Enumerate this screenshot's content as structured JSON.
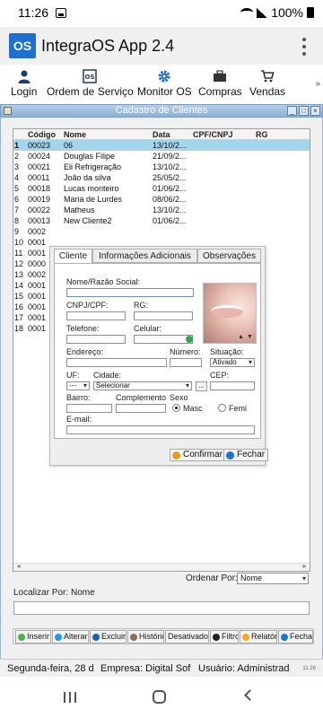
{
  "status_bar": {
    "time": "11:26",
    "battery": "100%"
  },
  "app_bar": {
    "logo": "OS",
    "title": "IntegraOS App 2.4",
    "menu_icon": "more-vert-icon"
  },
  "toolbar": {
    "items": [
      {
        "label": "Login",
        "icon": "person-icon"
      },
      {
        "label": "Ordem de Serviço",
        "icon": "service-order-icon"
      },
      {
        "label": "Monitor OS",
        "icon": "gear-icon"
      },
      {
        "label": "Compras",
        "icon": "briefcase-icon"
      },
      {
        "label": "Vendas",
        "icon": "cart-icon"
      }
    ],
    "more": "»"
  },
  "window": {
    "title": "Cadastro de Clientes"
  },
  "grid": {
    "columns": [
      "Código",
      "Nome",
      "Data",
      "CPF/CNPJ",
      "RG"
    ],
    "rows": [
      {
        "n": "1",
        "codigo": "00023",
        "nome": "06",
        "data": "13/10/2..."
      },
      {
        "n": "2",
        "codigo": "00024",
        "nome": "Douglas Filipe",
        "data": "21/09/2..."
      },
      {
        "n": "3",
        "codigo": "00021",
        "nome": "Eli Refrigeração",
        "data": "13/10/2..."
      },
      {
        "n": "4",
        "codigo": "00011",
        "nome": "João da silva",
        "data": "25/05/2..."
      },
      {
        "n": "5",
        "codigo": "00018",
        "nome": "Lucas monteiro",
        "data": "01/06/2..."
      },
      {
        "n": "6",
        "codigo": "00019",
        "nome": "Maria de Lurdes",
        "data": "08/06/2..."
      },
      {
        "n": "7",
        "codigo": "00022",
        "nome": "Matheus",
        "data": "13/10/2..."
      },
      {
        "n": "8",
        "codigo": "00013",
        "nome": "New Cliente2",
        "data": "01/06/2..."
      },
      {
        "n": "9",
        "codigo": "0002",
        "nome": "",
        "data": ""
      },
      {
        "n": "10",
        "codigo": "0001",
        "nome": "",
        "data": ""
      },
      {
        "n": "11",
        "codigo": "0001",
        "nome": "",
        "data": ""
      },
      {
        "n": "12",
        "codigo": "0000",
        "nome": "",
        "data": ""
      },
      {
        "n": "13",
        "codigo": "0002",
        "nome": "",
        "data": ""
      },
      {
        "n": "14",
        "codigo": "0001",
        "nome": "",
        "data": ""
      },
      {
        "n": "15",
        "codigo": "0001",
        "nome": "",
        "data": ""
      },
      {
        "n": "16",
        "codigo": "0001",
        "nome": "",
        "data": ""
      },
      {
        "n": "17",
        "codigo": "0001",
        "nome": "",
        "data": ""
      },
      {
        "n": "18",
        "codigo": "0001",
        "nome": "",
        "data": ""
      }
    ]
  },
  "form": {
    "tabs": [
      "Cliente",
      "Informações Adicionais",
      "Observações"
    ],
    "active_tab": "Cliente",
    "labels": {
      "nome": "Nome/Razão Social:",
      "cnpj": "CNPJ/CPF:",
      "rg": "RG:",
      "telefone": "Telefone:",
      "celular": "Celular:",
      "endereco": "Endereço:",
      "numero": "Número:",
      "situacao": "Situação:",
      "uf": "UF:",
      "cidade": "Cidade:",
      "cep": "CEP:",
      "bairro": "Bairro:",
      "complemento": "Complemento",
      "sexo": "Sexo",
      "email": "E-mail:"
    },
    "values": {
      "situacao": "Ativado",
      "uf": "---",
      "cidade": "Selecionar",
      "sexo_masc": "Masc",
      "sexo_fem": "Femi"
    },
    "buttons": {
      "confirmar": "Confirmar",
      "fechar": "Fechar",
      "city_more": "..."
    }
  },
  "ordenar": {
    "label": "Ordenar Por:",
    "value": "Nome"
  },
  "localizar": {
    "label": "Localizar Por:",
    "value": "Nome"
  },
  "bottom_toolbar": {
    "buttons": [
      {
        "label": "Inserir",
        "color": "#4caf50"
      },
      {
        "label": "Alterar",
        "color": "#2196f3"
      },
      {
        "label": "Excluir",
        "color": "#1565c0"
      },
      {
        "label": "Histórico",
        "color": "#8d6e63"
      },
      {
        "label": "Desativados",
        "color": "#9e9e9e"
      },
      {
        "label": "Filtro",
        "color": "#212121"
      },
      {
        "label": "Relatório",
        "color": "#f9a825"
      },
      {
        "label": "Fechar",
        "color": "#1976d2"
      }
    ]
  },
  "status_footer": {
    "date": "Segunda-feira, 28 d",
    "empresa": "Empresa: Digital Sof",
    "usuario": "Usuário: Administrad",
    "time": "11:26"
  },
  "colors": {
    "accent": "#1e6fd0",
    "selected_row": "#a3d5ec",
    "window_title": "#8eb0d6"
  }
}
